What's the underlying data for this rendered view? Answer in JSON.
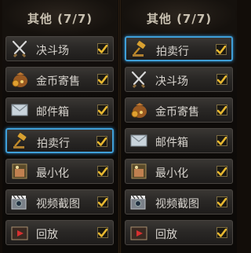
{
  "panels": [
    {
      "title": "其他 (7/7)",
      "items": [
        {
          "label": "决斗场",
          "icon": "crossed-swords-icon",
          "checked": true,
          "selected": false
        },
        {
          "label": "金币寄售",
          "icon": "coin-bag-icon",
          "checked": true,
          "selected": false
        },
        {
          "label": "邮件箱",
          "icon": "envelope-icon",
          "checked": true,
          "selected": false
        },
        {
          "label": "拍卖行",
          "icon": "gavel-icon",
          "checked": true,
          "selected": true
        },
        {
          "label": "最小化",
          "icon": "minimize-icon",
          "checked": true,
          "selected": false
        },
        {
          "label": "视频截图",
          "icon": "camera-icon",
          "checked": true,
          "selected": false
        },
        {
          "label": "回放",
          "icon": "replay-icon",
          "checked": true,
          "selected": false
        }
      ]
    },
    {
      "title": "其他 (7/7)",
      "items": [
        {
          "label": "拍卖行",
          "icon": "gavel-icon",
          "checked": true,
          "selected": true
        },
        {
          "label": "决斗场",
          "icon": "crossed-swords-icon",
          "checked": true,
          "selected": false
        },
        {
          "label": "金币寄售",
          "icon": "coin-bag-icon",
          "checked": true,
          "selected": false
        },
        {
          "label": "邮件箱",
          "icon": "envelope-icon",
          "checked": true,
          "selected": false
        },
        {
          "label": "最小化",
          "icon": "minimize-icon",
          "checked": true,
          "selected": false
        },
        {
          "label": "视频截图",
          "icon": "camera-icon",
          "checked": true,
          "selected": false
        },
        {
          "label": "回放",
          "icon": "replay-icon",
          "checked": true,
          "selected": false
        }
      ]
    }
  ],
  "colors": {
    "selection_border": "#3f9fd8",
    "check_mark": "#e8b830",
    "label_text": "#d8d4ce",
    "title_text": "#c8c0b0"
  }
}
